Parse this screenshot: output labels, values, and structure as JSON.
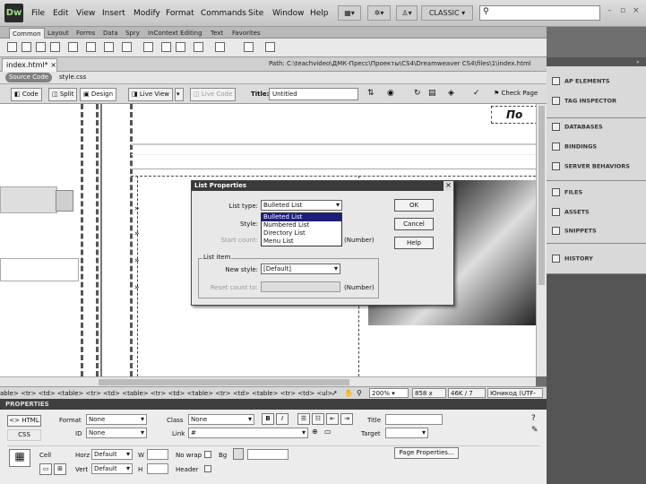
{
  "menubar": {
    "logo": "Dw",
    "items": [
      "File",
      "Edit",
      "View",
      "Insert",
      "Modify",
      "Format",
      "Commands",
      "Site",
      "Window",
      "Help"
    ],
    "workspace": "CLASSIC",
    "window_buttons": [
      "–",
      "▫",
      "×"
    ]
  },
  "insert_tabs": [
    "Common",
    "Layout",
    "Forms",
    "Data",
    "Spry",
    "InContext Editing",
    "Text",
    "Favorites"
  ],
  "document": {
    "tab": "index.html*",
    "path": "Path: C:\\teachvideo\\ДМК-Пресс\\Проекты\\CS4\\Dreamweaver CS4\\files\\1\\index.html",
    "related_source": "Source Code",
    "related_css": "style.css",
    "heading_text": "По",
    "toolbar": {
      "code": "Code",
      "split": "Split",
      "design": "Design",
      "live_view": "Live View",
      "live_code": "Live Code",
      "title_label": "Title:",
      "title_value": "Untitled",
      "check_page": "Check Page"
    }
  },
  "status": {
    "tag_path": "able> <tr> <td> <table> <tr> <td> <table> <tr> <td> <table> <tr> <td> <table> <tr> <td> <ul>",
    "zoom": "200%",
    "dimensions": "858 x 448",
    "download": "46K / 7 sec",
    "encoding": "Юникод (UTF-8)"
  },
  "properties": {
    "header": "PROPERTIES",
    "html_btn": "<> HTML",
    "css_btn": "CSS",
    "format_label": "Format",
    "format_value": "None",
    "class_label": "Class",
    "class_value": "None",
    "id_label": "ID",
    "id_value": "None",
    "link_label": "Link",
    "link_value": "#",
    "title_label": "Title",
    "target_label": "Target",
    "bold": "B",
    "italic": "I",
    "cell_label": "Cell",
    "horz_label": "Horz",
    "horz_value": "Default",
    "vert_label": "Vert",
    "vert_value": "Default",
    "w_label": "W",
    "h_label": "H",
    "nowrap_label": "No wrap",
    "header_label": "Header",
    "bg_label": "Bg",
    "page_props": "Page Properties..."
  },
  "panels": {
    "group1": [
      "AP ELEMENTS",
      "TAG INSPECTOR"
    ],
    "group2": [
      "DATABASES",
      "BINDINGS",
      "SERVER BEHAVIORS"
    ],
    "group3": [
      "FILES",
      "ASSETS",
      "SNIPPETS"
    ],
    "group4": [
      "HISTORY"
    ]
  },
  "dialog": {
    "title": "List Properties",
    "close": "×",
    "list_type_label": "List type:",
    "list_type_value": "Bulleted List",
    "style_label": "Style:",
    "start_count_label": "Start count:",
    "number_hint1": "(Number)",
    "options": [
      "Bulleted List",
      "Numbered List",
      "Directory List",
      "Menu List"
    ],
    "list_item_label": "List item",
    "new_style_label": "New style:",
    "new_style_value": "[Default]",
    "reset_count_label": "Reset count to:",
    "number_hint2": "(Number)",
    "ok": "OK",
    "cancel": "Cancel",
    "help": "Help"
  }
}
